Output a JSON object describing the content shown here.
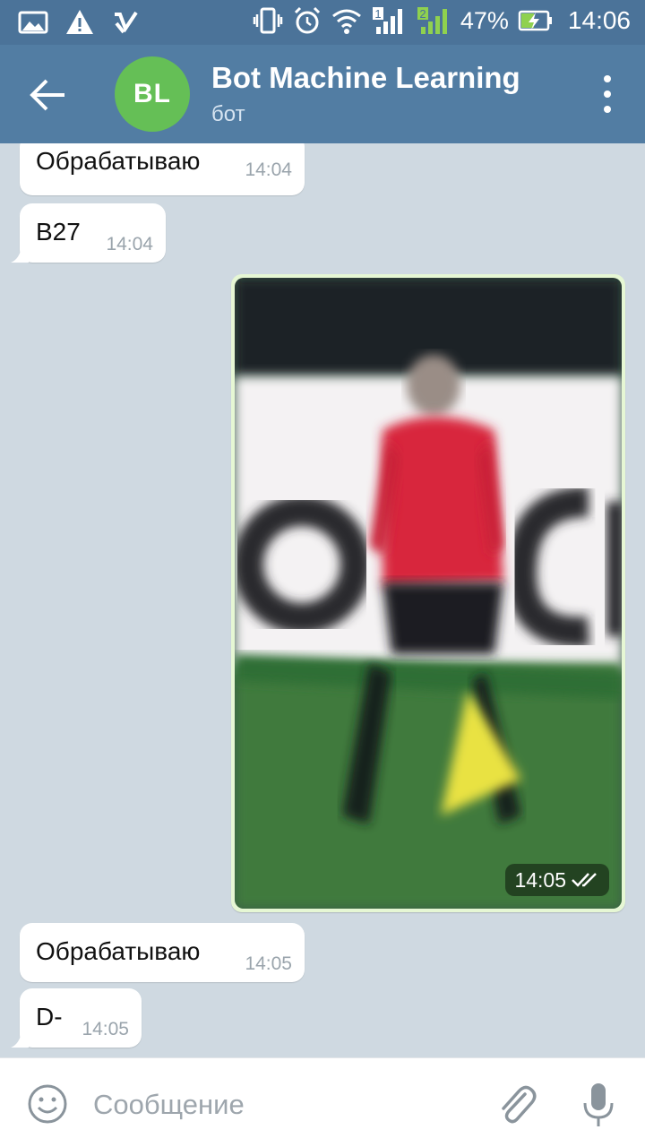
{
  "status_bar": {
    "battery_percent": "47%",
    "time": "14:06",
    "sim1_label": "1",
    "sim2_label": "2"
  },
  "header": {
    "avatar_initials": "BL",
    "title": "Bot Machine Learning",
    "subtitle": "бот",
    "avatar_color": "#65bf56"
  },
  "messages": [
    {
      "text": "Обрабатываю",
      "time": "14:04"
    },
    {
      "text": "B27",
      "time": "14:04"
    },
    {
      "type": "photo",
      "time": "14:05"
    },
    {
      "text": "Обрабатываю",
      "time": "14:05"
    },
    {
      "text": "D-",
      "time": "14:05"
    }
  ],
  "input": {
    "placeholder": "Сообщение"
  },
  "icons": [
    "back-arrow-icon",
    "more-vert-icon",
    "emoji-icon",
    "attach-icon",
    "mic-icon",
    "double-check-icon"
  ]
}
